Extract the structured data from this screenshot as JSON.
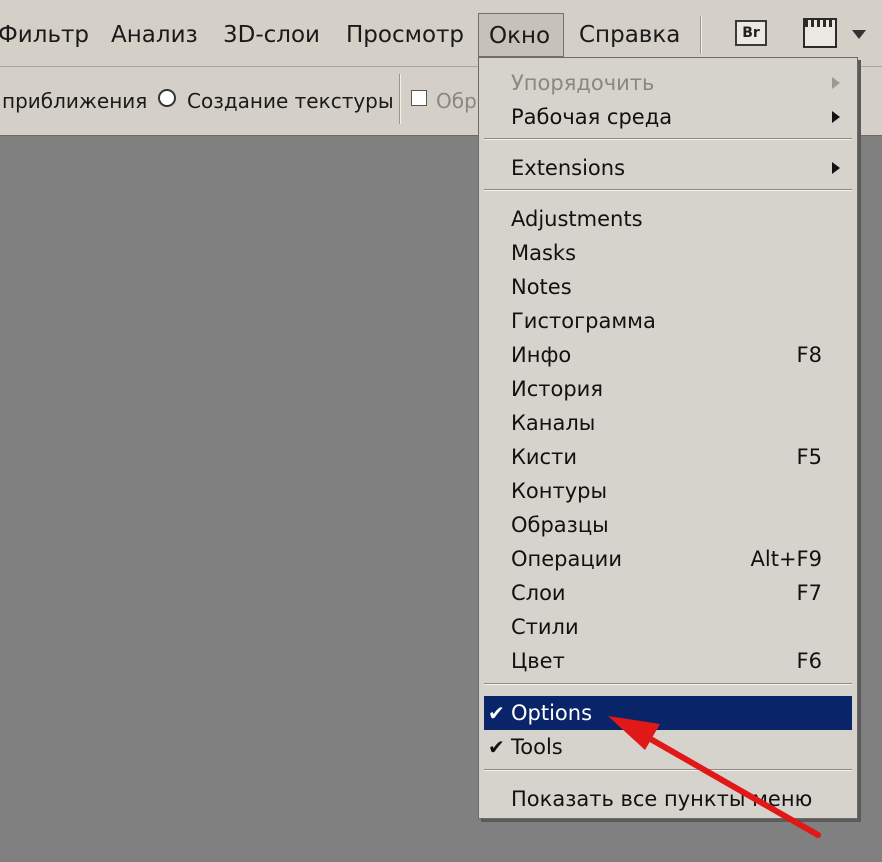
{
  "menubar": {
    "items": [
      "Фильтр",
      "Анализ",
      "3D-слои",
      "Просмотр",
      "Окно",
      "Справка"
    ],
    "active_item": "Окно",
    "bridge_label": "Br"
  },
  "options_bar": {
    "zoom_label": "приближения",
    "texture_label": "Создание текстуры",
    "checkbox_label": "Обр"
  },
  "window_menu": {
    "group1": [
      {
        "label": "Упорядочить",
        "disabled": true,
        "submenu": true
      },
      {
        "label": "Рабочая среда",
        "submenu": true
      }
    ],
    "group2": [
      {
        "label": "Extensions",
        "submenu": true
      }
    ],
    "group3": [
      {
        "label": "Adjustments",
        "shortcut": ""
      },
      {
        "label": "Masks",
        "shortcut": ""
      },
      {
        "label": "Notes",
        "shortcut": ""
      },
      {
        "label": "Гистограмма",
        "shortcut": ""
      },
      {
        "label": "Инфо",
        "shortcut": "F8"
      },
      {
        "label": "История",
        "shortcut": ""
      },
      {
        "label": "Каналы",
        "shortcut": ""
      },
      {
        "label": "Кисти",
        "shortcut": "F5"
      },
      {
        "label": "Контуры",
        "shortcut": ""
      },
      {
        "label": "Образцы",
        "shortcut": ""
      },
      {
        "label": "Операции",
        "shortcut": "Alt+F9"
      },
      {
        "label": "Слои",
        "shortcut": "F7"
      },
      {
        "label": "Стили",
        "shortcut": ""
      },
      {
        "label": "Цвет",
        "shortcut": "F6"
      }
    ],
    "group4": [
      {
        "label": "Options",
        "checked": true,
        "selected": true
      },
      {
        "label": "Tools",
        "checked": true
      }
    ],
    "group5": [
      {
        "label": "Показать все пункты меню"
      }
    ],
    "check_glyph": "✔"
  },
  "colors": {
    "selection": "#0a246a",
    "annotation_arrow": "#e01818"
  }
}
